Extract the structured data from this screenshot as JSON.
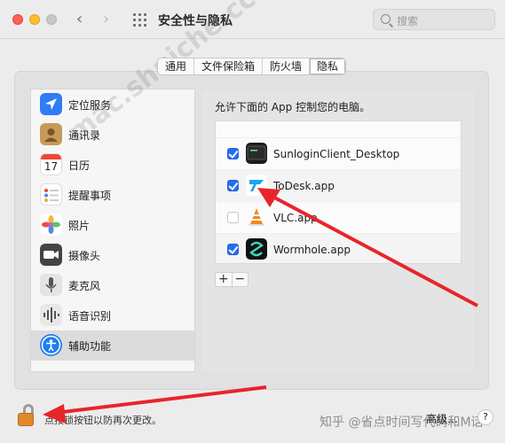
{
  "window": {
    "title": "安全性与隐私",
    "search_placeholder": "搜索"
  },
  "tabs": [
    {
      "label": "通用",
      "active": false
    },
    {
      "label": "文件保险箱",
      "active": false
    },
    {
      "label": "防火墙",
      "active": false
    },
    {
      "label": "隐私",
      "active": true
    }
  ],
  "sidebar": {
    "items": [
      {
        "label": "定位服务",
        "icon": "location-arrow-icon",
        "color": "#2f7cf6"
      },
      {
        "label": "通讯录",
        "icon": "contacts-book-icon",
        "color": "#c79a5a"
      },
      {
        "label": "日历",
        "icon": "calendar-icon",
        "color": "#ffffff"
      },
      {
        "label": "提醒事项",
        "icon": "reminders-list-icon",
        "color": "#ffffff"
      },
      {
        "label": "照片",
        "icon": "photos-flower-icon",
        "color": "#ffffff"
      },
      {
        "label": "摄像头",
        "icon": "camera-icon",
        "color": "#444444"
      },
      {
        "label": "麦克风",
        "icon": "microphone-icon",
        "color": "#cfcfcf"
      },
      {
        "label": "语音识别",
        "icon": "speech-recognition-icon",
        "color": "#d4d4d4"
      },
      {
        "label": "辅助功能",
        "icon": "accessibility-icon",
        "color": "#1f7ef0",
        "active": true
      }
    ],
    "calendar_day": "17"
  },
  "main": {
    "description": "允许下面的 App 控制您的电脑。",
    "apps": [
      {
        "name": "SunloginClient_Desktop",
        "checked": true,
        "icon": "sunlogin-terminal-icon"
      },
      {
        "name": "ToDesk.app",
        "checked": true,
        "icon": "todesk-icon"
      },
      {
        "name": "VLC.app",
        "checked": false,
        "icon": "vlc-cone-icon"
      },
      {
        "name": "Wormhole.app",
        "checked": true,
        "icon": "wormhole-icon"
      }
    ],
    "add_label": "+",
    "remove_label": "−"
  },
  "footer": {
    "lock_text": "点按锁按钮以防再次更改。",
    "advanced_label": "高级…",
    "help_label": "?"
  },
  "overlay": {
    "watermark": "知乎 @省点时间写代码和M话",
    "diagonal_watermark": "mac.shuiche.cc"
  },
  "colors": {
    "accent": "#2a6cf1",
    "arrow": "#e8252b"
  }
}
